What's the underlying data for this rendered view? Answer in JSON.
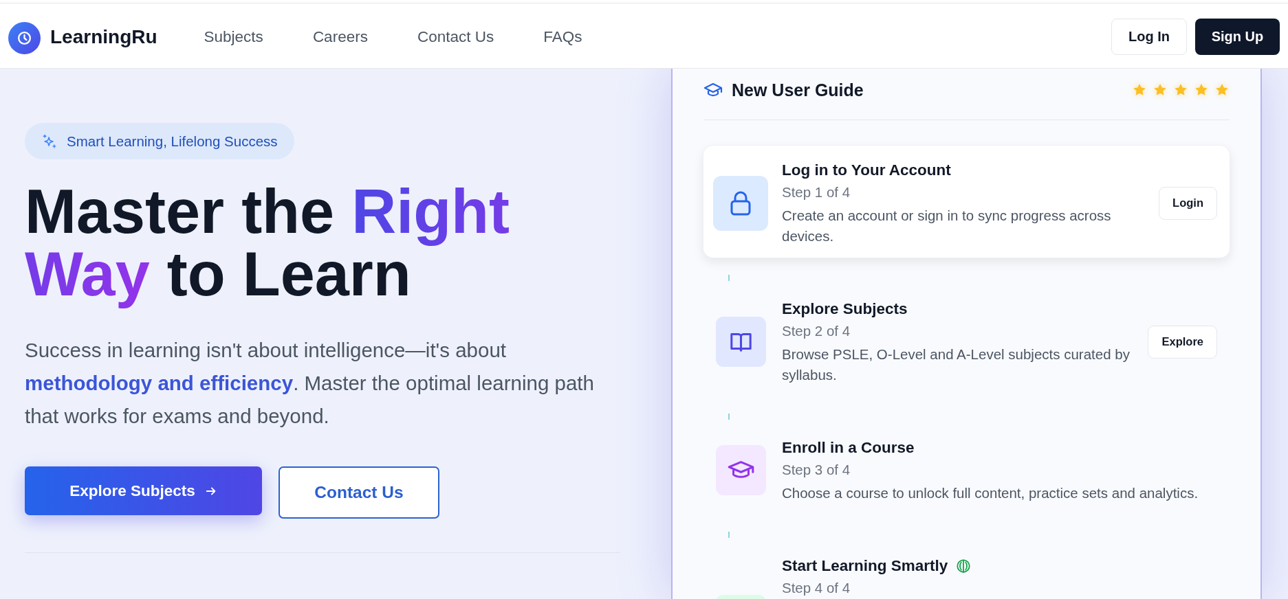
{
  "header": {
    "brand": "LearningRu",
    "nav": [
      "Subjects",
      "Careers",
      "Contact Us",
      "FAQs"
    ],
    "actions": [
      {
        "label": "Log In",
        "kind": "outline"
      },
      {
        "label": "Sign Up",
        "kind": "solid"
      }
    ]
  },
  "hero": {
    "badge": "Smart Learning, Lifelong Success",
    "headline": [
      {
        "text": "Master the ",
        "accent": false
      },
      {
        "text": "Right Way",
        "accent": true
      },
      {
        "text": " to Learn",
        "accent": false
      }
    ],
    "description": "Success in learning isn't about intelligence—it's about **methodology and efficiency**. Master the optimal learning path that works for exams and beyond.",
    "buttons": [
      {
        "label": "Explore Subjects",
        "kind": "primary"
      },
      {
        "label": "Contact Us",
        "kind": "outline"
      }
    ]
  },
  "guide": {
    "title": "New User Guide",
    "stars": 5,
    "steps": [
      {
        "title": "Log in to Your Account",
        "counter": "Step 1 of 4",
        "description": "Create an account or sign in to sync progress across devices.",
        "button": "Login",
        "selected": true
      },
      {
        "title": "Explore Subjects",
        "counter": "Step 2 of 4",
        "description": "Browse PSLE, O-Level and A-Level subjects curated by syllabus.",
        "button": "Explore",
        "selected": false
      },
      {
        "title": "Enroll in a Course",
        "counter": "Step 3 of 4",
        "description": "Choose a course to unlock full content, practice sets and analytics.",
        "selected": false
      },
      {
        "title": "Start Learning Smartly",
        "counter": "Step 4 of 4",
        "selected": false
      }
    ]
  }
}
